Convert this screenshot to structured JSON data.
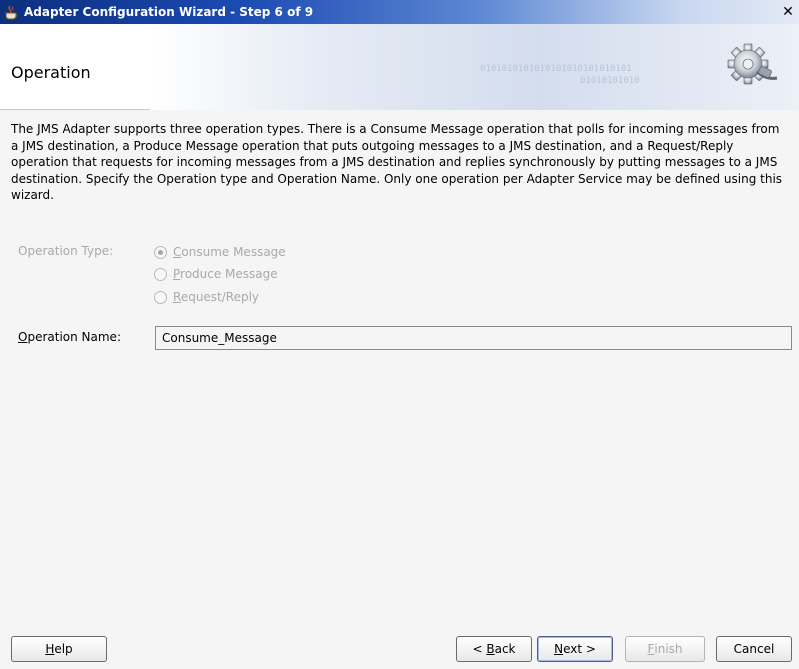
{
  "window": {
    "title": "Adapter Configuration Wizard - Step 6 of 9",
    "close_glyph": "✕"
  },
  "header": {
    "page_title": "Operation",
    "binary_line1": "0101010101010101010101010101",
    "binary_line2": "01010101010"
  },
  "description": "The JMS Adapter supports three operation types.  There is a Consume Message operation that polls for incoming messages from a JMS destination, a Produce Message operation that puts outgoing messages to a JMS destination, and a Request/Reply operation that requests for incoming messages from a JMS destination and replies synchronously by putting messages to a JMS destination.  Specify the Operation type and Operation Name.  Only one operation per Adapter Service may be defined using this wizard.",
  "operation_type": {
    "label": "Operation Type:",
    "options": [
      {
        "mnemonic": "C",
        "rest": "onsume Message",
        "checked": true
      },
      {
        "mnemonic": "P",
        "rest": "roduce Message",
        "checked": false
      },
      {
        "mnemonic": "R",
        "rest": "equest/Reply",
        "checked": false
      }
    ],
    "enabled": false
  },
  "operation_name": {
    "label_mnemonic": "O",
    "label_rest": "peration Name:",
    "value": "Consume_Message"
  },
  "buttons": {
    "help": {
      "mnemonic": "H",
      "rest": "elp"
    },
    "back": {
      "prefix": "< ",
      "mnemonic": "B",
      "rest": "ack"
    },
    "next": {
      "mnemonic": "N",
      "rest": "ext >"
    },
    "finish": {
      "mnemonic": "F",
      "rest": "inish"
    },
    "cancel": {
      "label": "Cancel"
    }
  },
  "colors": {
    "titlebar_start": "#0c2f7e",
    "titlebar_end": "#e4eaf6",
    "disabled_text": "#a9a9a9"
  },
  "icons": {
    "app": "java-coffee-cup-icon",
    "banner": "gear-plug-icon",
    "close": "close-icon"
  }
}
